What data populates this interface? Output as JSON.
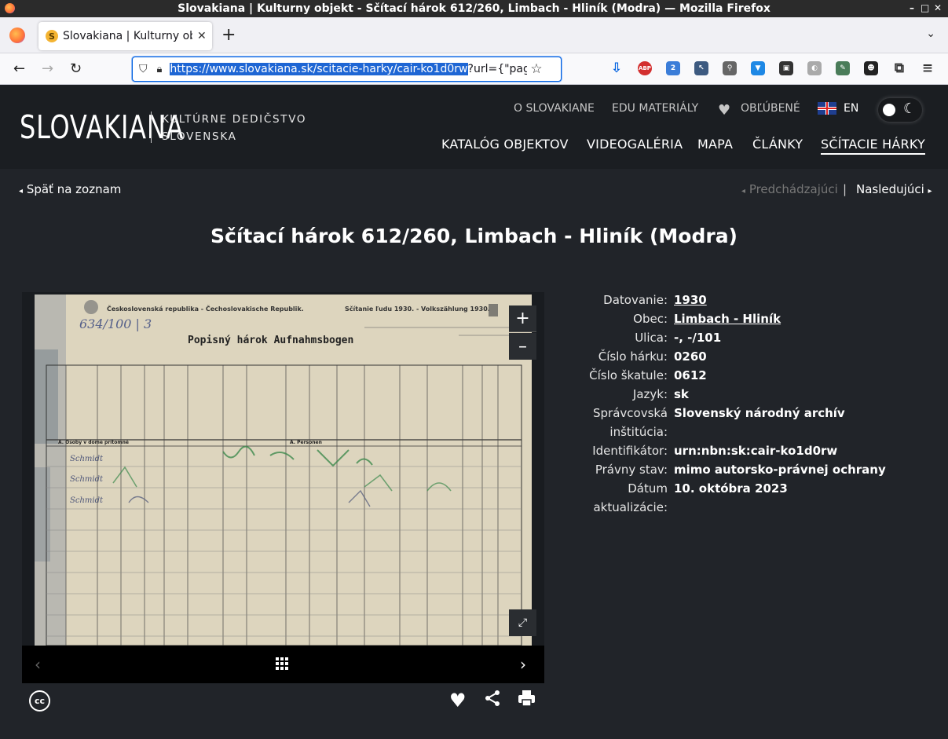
{
  "window": {
    "title": "Slovakiana | Kulturny objekt - Sčítací hárok 612/260, Limbach - Hliník (Modra) — Mozilla Firefox",
    "minimize": "–",
    "maximize": "□",
    "close": "✕"
  },
  "tab": {
    "title": "Slovakiana | Kulturny obj",
    "favicon_letter": "S",
    "close": "✕"
  },
  "newtab_label": "+",
  "tablist_label": "⌄",
  "nav": {
    "back": "←",
    "forward": "→",
    "reload": "↻"
  },
  "url": {
    "selected": "https://www.slovakiana.sk/scitacie-harky/cair-ko1d0rw",
    "rest": "?url={\"pag"
  },
  "extensions": [
    {
      "name": "download-icon",
      "label": "⇩",
      "color": "#0061e0"
    },
    {
      "name": "adblock-icon",
      "label": "ABP",
      "color": "#d32f2f"
    },
    {
      "name": "extension-badge-icon",
      "label": "2",
      "color": "#3b7dd8"
    },
    {
      "name": "cursor-icon",
      "label": "↖",
      "color": "#3d5a80"
    },
    {
      "name": "magnifier-icon",
      "label": "⚲",
      "color": "#666"
    },
    {
      "name": "shield-ext-icon",
      "label": "▼",
      "color": "#1e88e5"
    },
    {
      "name": "monitor-icon",
      "label": "▣",
      "color": "#333"
    },
    {
      "name": "cookie-icon",
      "label": "◐",
      "color": "#aaa"
    },
    {
      "name": "pen-icon",
      "label": "✎",
      "color": "#4a7c59"
    },
    {
      "name": "mask-icon",
      "label": "☻",
      "color": "#222"
    },
    {
      "name": "puzzle-icon",
      "label": "⧉",
      "color": "#333"
    },
    {
      "name": "menu-icon",
      "label": "≡",
      "color": "#333"
    }
  ],
  "site": {
    "logo": "SLOVAKIANA",
    "logo_sub_1": "KULTÚRNE DEDIČSTVO",
    "logo_sub_2": "SLOVENSKA",
    "top_links": {
      "about": "O SLOVAKIANE",
      "edu": "EDU MATERIÁLY",
      "favorites": "OBĽÚBENÉ",
      "lang": "EN"
    },
    "main_nav": [
      "KATALÓG OBJEKTOV",
      "VIDEOGALÉRIA",
      "MAPA",
      "ČLÁNKY",
      "SČÍTACIE HÁRKY"
    ],
    "back_label": "Späť na zoznam",
    "prev_label": "Predchádzajúci",
    "separator": "|",
    "next_label": "Nasledujúci",
    "page_title": "Sčítací hárok 612/260, Limbach - Hliník (Modra)"
  },
  "document": {
    "header_left": "Československá republika - Čechoslovakische Republik.",
    "header_right": "Sčítanie ľudu 1930. - Volkszählung 1930.",
    "title": "Popisný hárok   Aufnahmsbogen",
    "handwritten_number": "634/100 | 3",
    "section_a": "A. Osoby v dome prítomné",
    "section_b": "A. Personen",
    "names": [
      "Schmidt",
      "Schmidt",
      "Schmidt"
    ]
  },
  "viewer": {
    "zoom_in": "+",
    "zoom_out": "–",
    "fullscreen": "⤢",
    "prev": "‹",
    "next": "›",
    "cc": "cc"
  },
  "actions": {
    "heart": "♥",
    "share": "⋖",
    "print": "⎙"
  },
  "meta": [
    {
      "label": "Datovanie:",
      "value": "1930",
      "link": true
    },
    {
      "label": "Obec:",
      "value": "Limbach - Hliník",
      "link": true
    },
    {
      "label": "Ulica:",
      "value": "-, -/101",
      "link": false
    },
    {
      "label": "Číslo hárku:",
      "value": "0260",
      "link": false
    },
    {
      "label": "Číslo škatule:",
      "value": "0612",
      "link": false
    },
    {
      "label": "Jazyk:",
      "value": "sk",
      "link": false
    },
    {
      "label": "Správcovská inštitúcia:",
      "value": "Slovenský národný archív",
      "link": false
    },
    {
      "label": "Identifikátor:",
      "value": "urn:nbn:sk:cair-ko1d0rw",
      "link": false
    },
    {
      "label": "Právny stav:",
      "value": "mimo autorsko-právnej ochrany",
      "link": false
    },
    {
      "label": "Dátum aktualizácie:",
      "value": "10. októbra 2023",
      "link": false
    }
  ]
}
